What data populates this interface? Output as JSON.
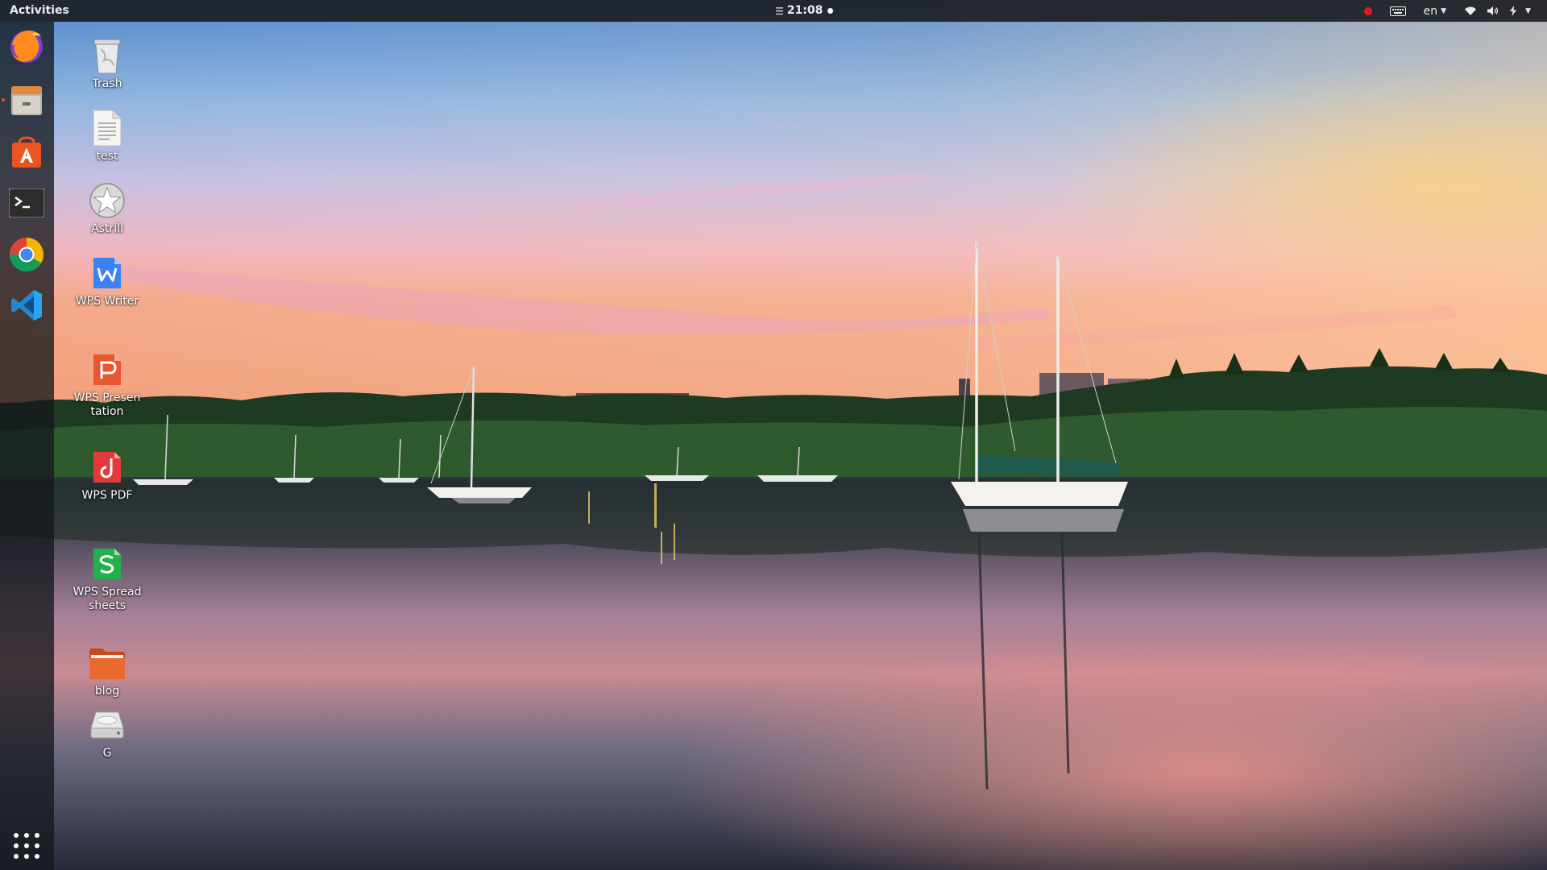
{
  "topbar": {
    "activities_label": "Activities",
    "clock": "21:08",
    "lang": "en",
    "record_color": "#e01b24"
  },
  "dock": {
    "items": [
      {
        "name": "firefox",
        "icon": "firefox-icon"
      },
      {
        "name": "files",
        "icon": "file-cabinet-icon",
        "running": true
      },
      {
        "name": "software",
        "icon": "software-center-icon"
      },
      {
        "name": "terminal",
        "icon": "terminal-icon"
      },
      {
        "name": "chrome",
        "icon": "chrome-icon"
      },
      {
        "name": "vscode",
        "icon": "vscode-icon"
      }
    ],
    "show_apps_icon": "app-grid-icon",
    "accent": "#e95420"
  },
  "desktop_icons": [
    {
      "label": "Trash",
      "icon": "trash-icon"
    },
    {
      "label": "test",
      "icon": "text-document-icon"
    },
    {
      "label": "Astrill",
      "icon": "astrill-star-icon"
    },
    {
      "label": "WPS Writer",
      "icon": "wps-writer-icon",
      "color": "#3b82f6"
    },
    {
      "label": "WPS Presentation",
      "icon": "wps-presentation-icon",
      "color": "#e8572f"
    },
    {
      "label": "WPS PDF",
      "icon": "wps-pdf-icon",
      "color": "#e03a3a"
    },
    {
      "label": "WPS Spreadsheets",
      "icon": "wps-spreadsheets-icon",
      "color": "#22b14c"
    },
    {
      "label": "blog",
      "icon": "folder-icon",
      "color": "#e5622a"
    },
    {
      "label": "G",
      "icon": "drive-icon"
    }
  ],
  "wallpaper": {
    "subject": "harbor-sunset-sailboats-icon"
  }
}
